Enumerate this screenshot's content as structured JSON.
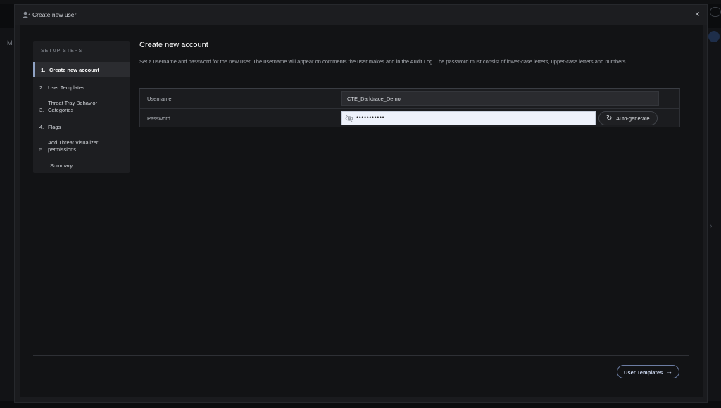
{
  "modal": {
    "title": "Create new user",
    "close_glyph": "×"
  },
  "background": {
    "left_fragment": "M"
  },
  "sidebar": {
    "heading": "SETUP STEPS",
    "steps": [
      {
        "num": "1.",
        "label": "Create new account",
        "active": true
      },
      {
        "num": "2.",
        "label": "User Templates"
      },
      {
        "num": "3.",
        "label": "Threat Tray Behavior Categories"
      },
      {
        "num": "4.",
        "label": "Flags"
      },
      {
        "num": "5.",
        "label": "Add Threat Visualizer permissions"
      },
      {
        "num": "",
        "label": "Summary"
      }
    ]
  },
  "content": {
    "title": "Create new account",
    "description": "Set a username and password for the new user. The username will appear on comments the user makes and in the Audit Log. The password must consist of lower-case letters, upper-case letters and numbers."
  },
  "form": {
    "username_label": "Username",
    "username_value": "CTE_Darktrace_Demo",
    "password_label": "Password",
    "password_value": "•••••••••••",
    "autogen_label": "Auto-generate"
  },
  "footer": {
    "next_label": "User Templates",
    "next_arrow": "→"
  },
  "colors": {
    "accent": "#8fa2c4",
    "modal_bg": "#1a1b1e",
    "body_bg": "#121315"
  },
  "icons": [
    "user-add-icon",
    "close-icon",
    "eye-off-icon",
    "refresh-icon",
    "arrow-right-icon"
  ]
}
